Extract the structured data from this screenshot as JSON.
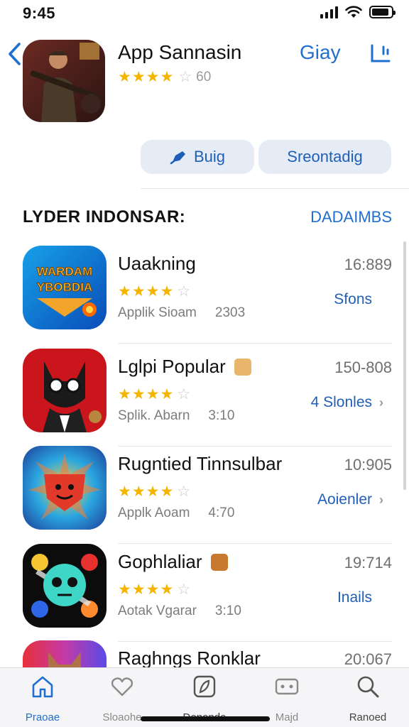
{
  "status_bar": {
    "time": "9:45",
    "battery_level": 0.9
  },
  "header": {
    "title": "App Sannasin",
    "rating_stars": "★★★★",
    "rating_count": "60",
    "link_label": "Giay",
    "back_icon": "chevron-left-icon",
    "share_icon": "share-icon"
  },
  "actions": {
    "bug_label": "Buig",
    "sort_label": "Sreontadig"
  },
  "section": {
    "title": "LYDER INDONSAR:",
    "link": "DADAIMBS"
  },
  "apps": [
    {
      "name": "Uaakning",
      "stars": "★★★★",
      "meta_left": "Applik Sioam",
      "meta_right": "2303",
      "size": "16:889",
      "action": "Sfons"
    },
    {
      "name": "Lglpi Popular",
      "stars": "★★★★",
      "meta_left": "Splik. Abarn",
      "meta_right": "3:10",
      "size": "150-808",
      "action": "4 Slonles"
    },
    {
      "name": "Rugntied Tinnsulbar",
      "stars": "★★★★",
      "meta_left": "Applk Aoam",
      "meta_right": "4:70",
      "size": "10:905",
      "action": "Aoienler"
    },
    {
      "name": "Gophlaliar",
      "stars": "★★★★",
      "meta_left": "Aotak Vgarar",
      "meta_right": "3:10",
      "size": "19:714",
      "action": "Inails"
    },
    {
      "name": "Raghngs Ronklar",
      "stars": "",
      "meta_left": "",
      "meta_right": "",
      "size": "20:067",
      "action": ""
    }
  ],
  "icon_texts": {
    "app1_logo": "WARDAM YBOBDIA"
  },
  "tabs": [
    {
      "label": "Praoae",
      "icon": "home-icon"
    },
    {
      "label": "Sloaohe",
      "icon": "heart-icon"
    },
    {
      "label": "Denende",
      "icon": "apps-icon"
    },
    {
      "label": "Majd",
      "icon": "games-icon"
    },
    {
      "label": "Ranoed",
      "icon": "search-icon"
    }
  ],
  "colors": {
    "accent": "#1f6fd1",
    "star": "#f4b400",
    "button_bg": "#e6ecf5"
  }
}
